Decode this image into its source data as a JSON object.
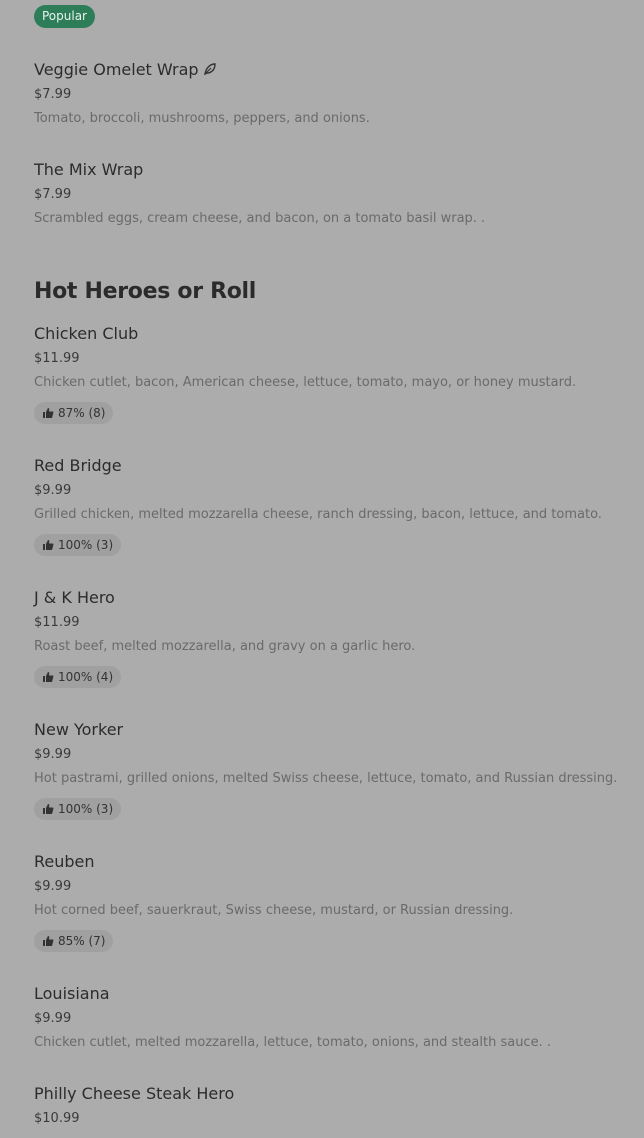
{
  "popular_badge": "Popular",
  "items_top": [
    {
      "name": "Veggie Omelet Wrap",
      "price": "$7.99",
      "desc": "Tomato, broccoli, mushrooms, peppers, and onions."
    },
    {
      "name": "The Mix Wrap",
      "price": "$7.99",
      "desc": "Scrambled eggs, cream cheese, and bacon, on a tomato basil wrap. ."
    }
  ],
  "section": {
    "title": "Hot Heroes or Roll",
    "items": [
      {
        "name": "Chicken Club",
        "price": "$11.99",
        "desc": "Chicken cutlet, bacon, American cheese, lettuce, tomato, mayo, or honey mustard.",
        "rating": "87% (8)"
      },
      {
        "name": "Red Bridge",
        "price": "$9.99",
        "desc": "Grilled chicken, melted mozzarella cheese, ranch dressing, bacon, lettuce, and tomato.",
        "rating": "100% (3)"
      },
      {
        "name": "J & K Hero",
        "price": "$11.99",
        "desc": "Roast beef, melted mozzarella, and gravy on a garlic hero.",
        "rating": "100% (4)"
      },
      {
        "name": "New Yorker",
        "price": "$9.99",
        "desc": "Hot pastrami, grilled onions, melted Swiss cheese, lettuce, tomato, and Russian dressing.",
        "rating": "100% (3)"
      },
      {
        "name": "Reuben",
        "price": "$9.99",
        "desc": "Hot corned beef, sauerkraut, Swiss cheese, mustard, or Russian dressing.",
        "rating": "85% (7)"
      },
      {
        "name": "Louisiana",
        "price": "$9.99",
        "desc": "Chicken cutlet, melted mozzarella, lettuce, tomato, onions, and stealth sauce. ."
      },
      {
        "name": "Philly Cheese Steak Hero",
        "price": "$10.99"
      }
    ]
  },
  "colors": {
    "background": "#acacac",
    "popular_badge": "#2e7d59",
    "rating_pill": "#a0a0a0"
  },
  "icons": {
    "vegetarian": "leaf-icon",
    "rating": "thumbs-up-icon"
  }
}
